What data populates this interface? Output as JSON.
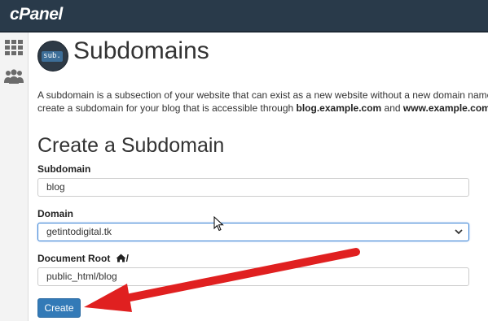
{
  "app": {
    "logo_text": "cPanel"
  },
  "sidebar": {
    "items": [
      {
        "icon": "grid-icon"
      },
      {
        "icon": "users-icon"
      }
    ]
  },
  "header": {
    "badge_text": "sub.",
    "title": "Subdomains"
  },
  "description": {
    "line1": "A subdomain is a subsection of your website that can exist as a new website without a new domain name. Use s",
    "line2_prefix": "create a subdomain for your blog that is accessible through ",
    "example1": "blog.example.com",
    "line2_mid": " and ",
    "example2": "www.example.com/blog"
  },
  "form": {
    "title": "Create a Subdomain",
    "subdomain_label": "Subdomain",
    "subdomain_value": "blog",
    "domain_label": "Domain",
    "domain_value": "getintodigital.tk",
    "docroot_label": "Document Root",
    "docroot_suffix": "/",
    "docroot_value": "public_html/blog",
    "create_label": "Create"
  },
  "colors": {
    "topbar": "#293a4a",
    "primary_button": "#337ab7",
    "annotation_arrow": "#e02020"
  }
}
